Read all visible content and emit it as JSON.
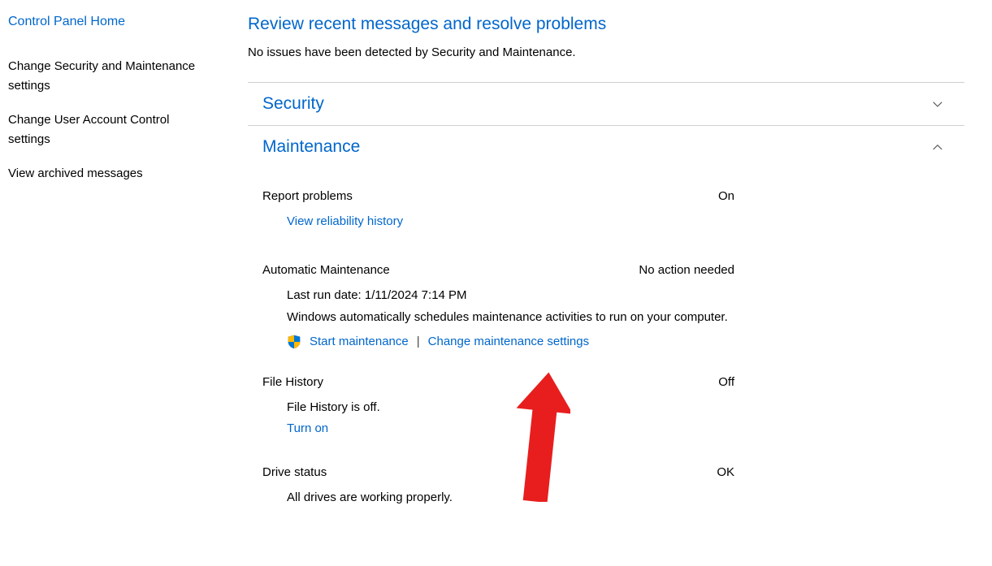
{
  "sidebar": {
    "home": "Control Panel Home",
    "links": [
      "Change Security and Maintenance settings",
      "Change User Account Control settings",
      "View archived messages"
    ]
  },
  "main": {
    "title": "Review recent messages and resolve problems",
    "status": "No issues have been detected by Security and Maintenance."
  },
  "security": {
    "title": "Security"
  },
  "maintenance": {
    "title": "Maintenance",
    "report": {
      "label": "Report problems",
      "status": "On",
      "link": "View reliability history"
    },
    "auto": {
      "label": "Automatic Maintenance",
      "status": "No action needed",
      "last_run": "Last run date: 1/11/2024 7:14 PM",
      "desc": "Windows automatically schedules maintenance activities to run on your computer.",
      "start": "Start maintenance",
      "change": "Change maintenance settings"
    },
    "file_history": {
      "label": "File History",
      "status": "Off",
      "desc": "File History is off.",
      "turn_on": "Turn on"
    },
    "drive": {
      "label": "Drive status",
      "status": "OK",
      "desc": "All drives are working properly."
    }
  }
}
